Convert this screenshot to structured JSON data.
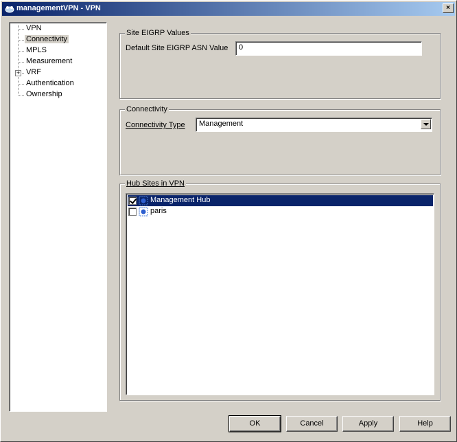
{
  "window": {
    "title": "managementVPN - VPN",
    "close_glyph": "×",
    "app_icon": "vpn-app-icon"
  },
  "tree": {
    "items": [
      {
        "label": "VPN",
        "expandable": false,
        "selected": false
      },
      {
        "label": "Connectivity",
        "expandable": false,
        "selected": true
      },
      {
        "label": "MPLS",
        "expandable": false,
        "selected": false
      },
      {
        "label": "Measurement",
        "expandable": false,
        "selected": false
      },
      {
        "label": "VRF",
        "expandable": true,
        "selected": false,
        "expander_glyph": "+"
      },
      {
        "label": "Authentication",
        "expandable": false,
        "selected": false
      },
      {
        "label": "Ownership",
        "expandable": false,
        "selected": false
      }
    ]
  },
  "eigrp": {
    "group_title": "Site EIGRP Values",
    "asn_label": "Default Site EIGRP ASN Value",
    "asn_value": "0"
  },
  "connectivity": {
    "group_title": "Connectivity",
    "type_label": "Connectivity Type",
    "type_value": "Management"
  },
  "hub_sites": {
    "group_title": "Hub Sites in VPN",
    "rows": [
      {
        "label": "Management Hub",
        "checked": true,
        "selected": true
      },
      {
        "label": "paris",
        "checked": false,
        "selected": false
      }
    ]
  },
  "buttons": {
    "ok": "OK",
    "cancel": "Cancel",
    "apply": "Apply",
    "help": "Help"
  },
  "colors": {
    "selection": "#0a246a",
    "face": "#d4d0c8"
  }
}
